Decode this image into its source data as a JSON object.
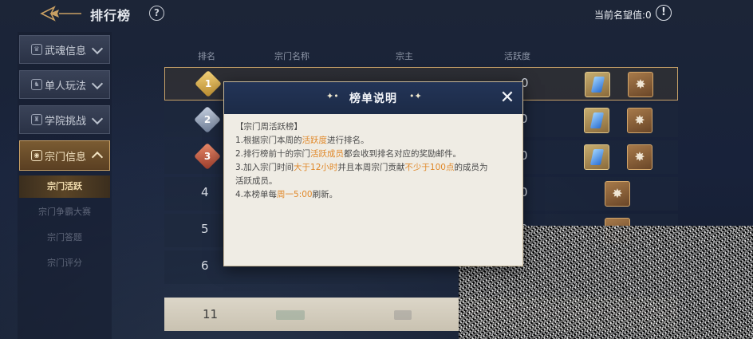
{
  "topbar": {
    "title": "排行榜",
    "help": "?",
    "fame_label": "当前名望值:0",
    "info_icon": "!"
  },
  "sidebar": {
    "items": [
      {
        "label": "武魂信息",
        "icon": "wuhun-icon"
      },
      {
        "label": "单人玩法",
        "icon": "solo-icon"
      },
      {
        "label": "学院挑战",
        "icon": "academy-icon"
      },
      {
        "label": "宗门信息",
        "icon": "sect-icon",
        "active": true
      }
    ],
    "sub_items": [
      "宗门活跃",
      "宗门争霸大赛",
      "宗门答题",
      "宗门评分"
    ]
  },
  "table": {
    "headers": [
      "排名",
      "宗门名称",
      "宗主",
      "活跃度"
    ],
    "rows": [
      {
        "rank": "1",
        "activity": "0",
        "rewards": [
          "blue-crystal",
          "gold-token"
        ]
      },
      {
        "rank": "2",
        "activity": "0",
        "rewards": [
          "blue-crystal",
          "gold-token"
        ]
      },
      {
        "rank": "3",
        "activity": "0",
        "rewards": [
          "blue-crystal",
          "gold-token"
        ]
      },
      {
        "rank": "4",
        "activity": "0",
        "rewards": [
          "gold-token"
        ]
      },
      {
        "rank": "5",
        "activity": "0",
        "rewards": [
          "gold-token"
        ]
      },
      {
        "rank": "6",
        "activity": "",
        "rewards": []
      }
    ],
    "self_row": {
      "rank": "11"
    }
  },
  "modal": {
    "title": "榜单说明",
    "deco_left": "✦•",
    "deco_right": "•✦",
    "close": "✕",
    "heading": "【宗门周活跃榜】",
    "line1": {
      "a": "1.根据宗门本周的",
      "b": "活跃度",
      "c": "进行排名。"
    },
    "line2": {
      "a": "2.排行榜前十的宗门",
      "b": "活跃成员",
      "c": "都会收到排名对应的奖励邮件。"
    },
    "line3": {
      "a": "3.加入宗门时间",
      "b": "大于12小时",
      "c": "并且本周宗门贡献",
      "d": "不少于100点",
      "e": "的成员为"
    },
    "line3b": "活跃成员。",
    "line4": {
      "a": "4.本榜单每",
      "b": "周一5:00",
      "c": "刷新。"
    }
  },
  "colors": {
    "highlight": "#e0892b",
    "gold_border": "#c8a268",
    "modal_header": "#233457"
  }
}
